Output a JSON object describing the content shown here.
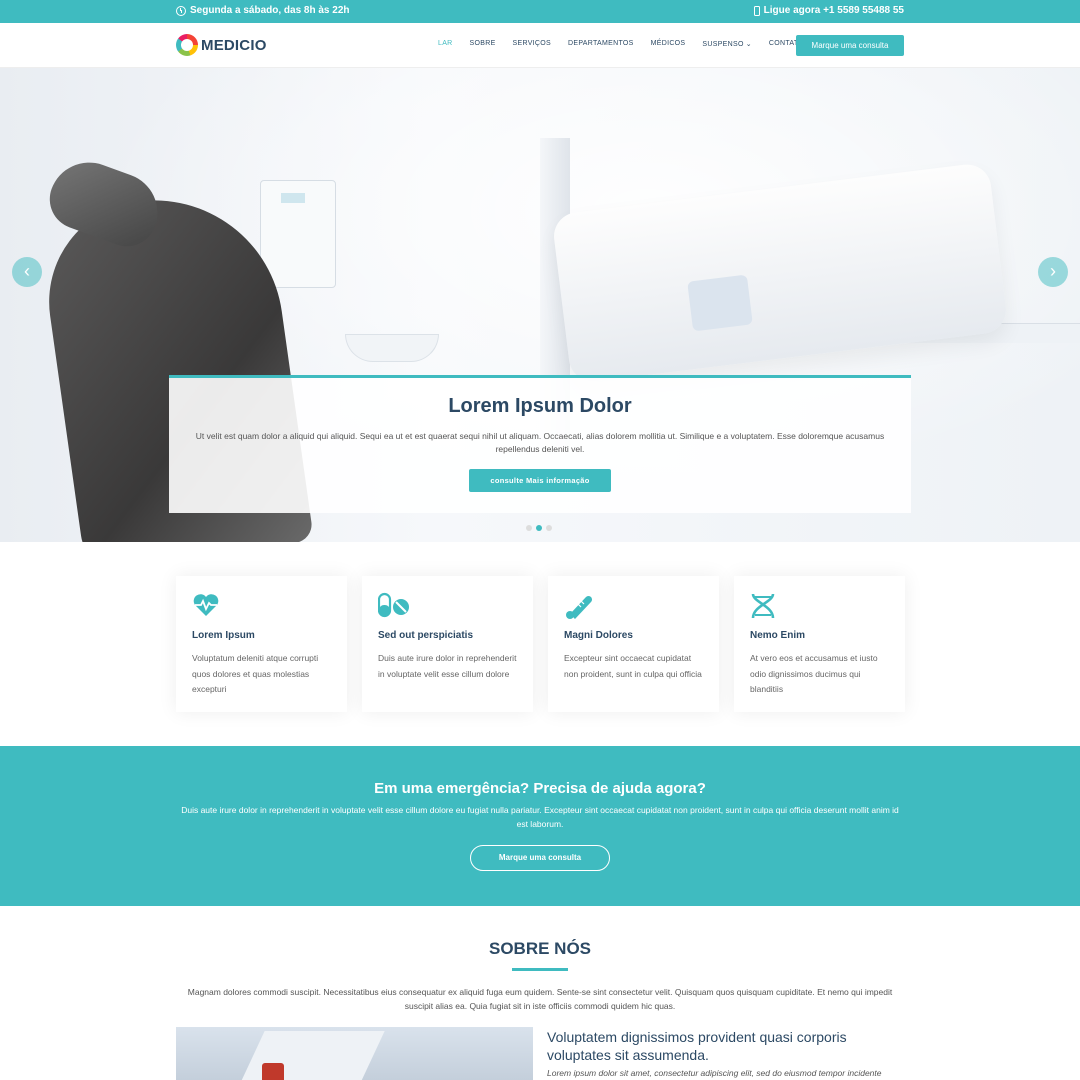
{
  "topbar": {
    "hours": "Segunda a sábado, das 8h às 22h",
    "phone": "Ligue agora +1 5589 55488 55"
  },
  "header": {
    "logo": "MEDICIO",
    "nav": [
      "Lar",
      "Sobre",
      "Serviços",
      "Departamentos",
      "Médicos",
      "Suspenso",
      "Contato"
    ],
    "cta": "Marque uma consulta"
  },
  "hero": {
    "title": "Lorem Ipsum Dolor",
    "text": "Ut velit est quam dolor a aliquid qui aliquid. Sequi ea ut et est quaerat sequi nihil ut aliquam. Occaecati, alias dolorem mollitia ut. Similique e a voluptatem. Esse doloremque acusamus repellendus deleniti vel.",
    "button": "consulte Mais informação",
    "slides": 3,
    "active_slide": 2
  },
  "features": [
    {
      "icon": "heart-pulse-icon",
      "title": "Lorem Ipsum",
      "text": "Voluptatum deleniti atque corrupti quos dolores et quas molestias excepturi"
    },
    {
      "icon": "capsule-icon",
      "title": "Sed out perspiciatis",
      "text": "Duis aute irure dolor in reprehenderit in voluptate velit esse cillum dolore"
    },
    {
      "icon": "thermometer-icon",
      "title": "Magni Dolores",
      "text": "Excepteur sint occaecat cupidatat non proident, sunt in culpa qui officia"
    },
    {
      "icon": "dna-icon",
      "title": "Nemo Enim",
      "text": "At vero eos et accusamus et iusto odio dignissimos ducimus qui blanditiis"
    }
  ],
  "emergency": {
    "title": "Em uma emergência? Precisa de ajuda agora?",
    "text": "Duis aute irure dolor in reprehenderit in voluptate velit esse cillum dolore eu fugiat nulla pariatur. Excepteur sint occaecat cupidatat non proident, sunt in culpa qui officia deserunt mollit anim id est laborum.",
    "button": "Marque uma consulta"
  },
  "about": {
    "title": "SOBRE NÓS",
    "text": "Magnam dolores commodi suscipit. Necessitatibus eius consequatur ex aliquid fuga eum quidem. Sente-se sint consectetur velit. Quisquam quos quisquam cupiditate. Et nemo qui impedit suscipit alias ea. Quia fugiat sit in iste officiis commodi quidem hic quas.",
    "heading": "Voluptatem dignissimos provident quasi corporis voluptates sit assumenda.",
    "subtext": "Lorem ipsum dolor sit amet, consectetur adipiscing elit, sed do eiusmod tempor incidente"
  },
  "colors": {
    "accent": "#3fbbc0",
    "heading": "#2c4964"
  }
}
